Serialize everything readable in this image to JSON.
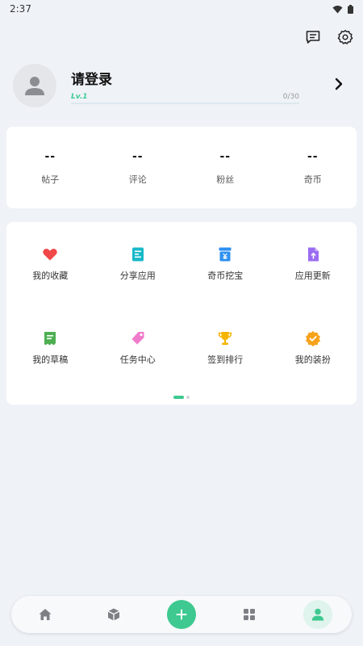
{
  "status_bar": {
    "time": "2:37"
  },
  "profile": {
    "login_prompt": "请登录",
    "level_badge": "Lv.1",
    "level_progress": "0/30",
    "progress_fraction": 0
  },
  "stats": [
    {
      "value": "--",
      "label": "帖子"
    },
    {
      "value": "--",
      "label": "评论"
    },
    {
      "value": "--",
      "label": "粉丝"
    },
    {
      "value": "--",
      "label": "奇币"
    }
  ],
  "menu": [
    {
      "label": "我的收藏",
      "icon": "heart-icon",
      "color": "#f04848"
    },
    {
      "label": "分享应用",
      "icon": "share-doc-icon",
      "color": "#19b8c9"
    },
    {
      "label": "奇币挖宝",
      "icon": "coin-box-icon",
      "color": "#2d8ff0"
    },
    {
      "label": "应用更新",
      "icon": "update-file-icon",
      "color": "#9b6cf2"
    },
    {
      "label": "我的草稿",
      "icon": "draft-icon",
      "color": "#4caf50"
    },
    {
      "label": "任务中心",
      "icon": "tag-icon",
      "color": "#f07acb"
    },
    {
      "label": "签到排行",
      "icon": "trophy-icon",
      "color": "#f5b400"
    },
    {
      "label": "我的装扮",
      "icon": "badge-icon",
      "color": "#f7a21b"
    }
  ],
  "bottom_nav": {
    "items": [
      "home-icon",
      "cube-icon",
      "add-icon",
      "apps-icon",
      "person-icon"
    ],
    "active": "person-icon",
    "accent": "#3ec990"
  }
}
